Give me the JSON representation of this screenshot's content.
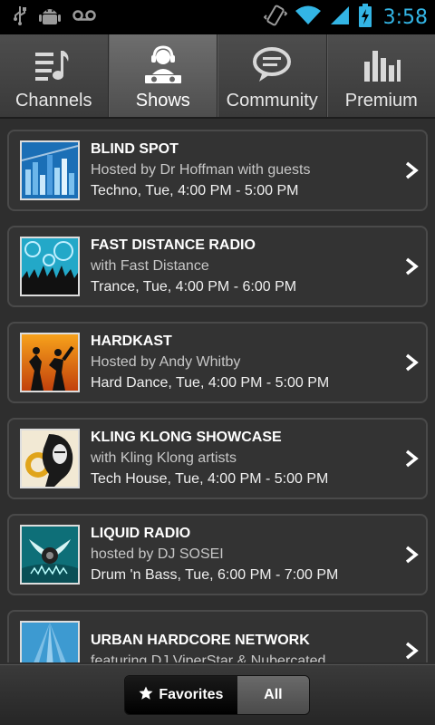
{
  "status_bar": {
    "time": "3:58",
    "accent_color": "#33b5e5",
    "left_icons": [
      "usb-icon",
      "android-debug-icon",
      "voicemail-icon"
    ],
    "right_icons": [
      "vibrate-icon",
      "wifi-icon",
      "signal-icon",
      "battery-charging-icon"
    ]
  },
  "tabs": [
    {
      "label": "Channels",
      "icon": "music-list-icon"
    },
    {
      "label": "Shows",
      "icon": "dj-icon"
    },
    {
      "label": "Community",
      "icon": "chat-bubble-icon"
    },
    {
      "label": "Premium",
      "icon": "equalizer-icon"
    }
  ],
  "active_tab": "Shows",
  "shows": [
    {
      "title": "BLIND SPOT",
      "host": "Hosted by Dr Hoffman with guests",
      "meta": "Techno, Tue, 4:00 PM - 5:00 PM"
    },
    {
      "title": "FAST DISTANCE RADIO",
      "host": "with Fast Distance",
      "meta": "Trance, Tue, 4:00 PM - 6:00 PM"
    },
    {
      "title": "HARDKAST",
      "host": "Hosted by Andy Whitby",
      "meta": "Hard Dance, Tue, 4:00 PM - 5:00 PM"
    },
    {
      "title": "KLING KLONG SHOWCASE",
      "host": "with Kling Klong artists",
      "meta": "Tech House, Tue, 4:00 PM - 5:00 PM"
    },
    {
      "title": "LIQUID RADIO",
      "host": "hosted by DJ SOSEI",
      "meta": "Drum 'n Bass, Tue, 6:00 PM - 7:00 PM"
    },
    {
      "title": "URBAN HARDCORE NETWORK",
      "host": "featuring DJ ViperStar & Nubercated",
      "meta": ""
    }
  ],
  "bottom": {
    "favorites_label": "Favorites",
    "all_label": "All",
    "selected": "Favorites"
  }
}
